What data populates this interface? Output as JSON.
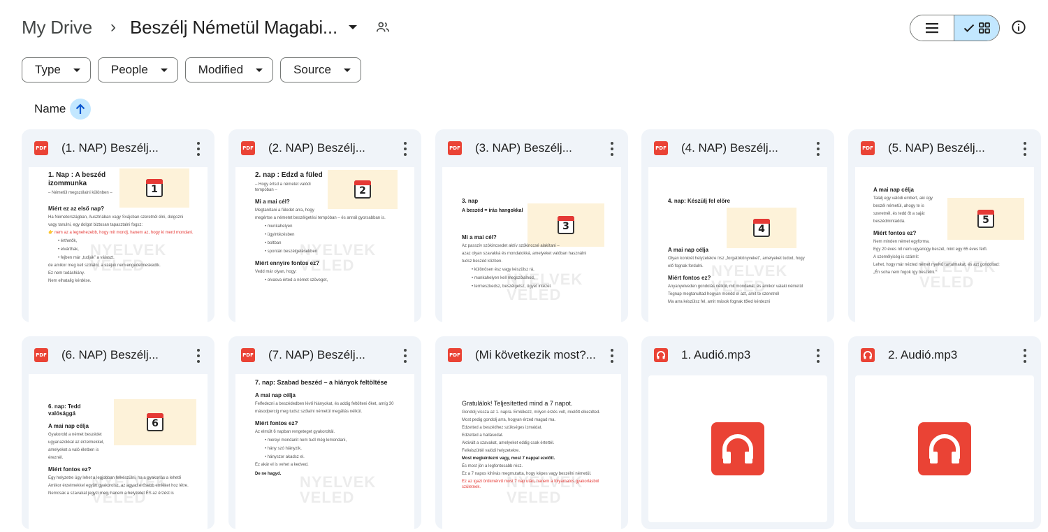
{
  "breadcrumb": {
    "root": "My Drive",
    "separator": "›",
    "current": "Beszélj Németül Magabi..."
  },
  "filters": [
    "Type",
    "People",
    "Modified",
    "Source"
  ],
  "sort": {
    "label": "Name"
  },
  "files": [
    {
      "title": "(1. NAP) Beszélj...",
      "type": "pdf",
      "icon_label": "PDF",
      "preview": {
        "heading": "1. Nap : A beszéd izommunka",
        "sub": "– Németül megszólalni különben –",
        "section": "Miért ez az első nap?",
        "lines": [
          "Ha Németországban, Ausztriában vagy Svájcban szeretnél élni, dolgozni",
          "vagy tanulni, egy dolgot biztosan tapasztalni fogsz:"
        ],
        "highlight": "👉 nem az a legnehezebb, hogy mit mondj, hanem az, hogy ki merd mondani.",
        "bullets": [
          "• érthetők,",
          "• elvárthak,",
          "• fejben már „tudják” a választ."
        ],
        "footer": [
          "de amikor meg kell szólalni, a szájuk nem engedelmeskedik.",
          "Ez nem tudáshiány.",
          "Nem elhatalig kérdése."
        ],
        "day_number": "1",
        "watermark": "NYELVEK VELED"
      }
    },
    {
      "title": "(2. NAP) Beszélj...",
      "type": "pdf",
      "icon_label": "PDF",
      "preview": {
        "heading": "2. nap : Edzd a füled",
        "sub": "– Hogy értsd a németet valódi tempóban –",
        "section": "Mi a mai cél?",
        "lines": [
          "Megtanítani a füledet arra, hogy",
          "megértse a németet beszélgetési tempóban – és annál gyorsabban is."
        ],
        "highlight": "",
        "bullets": [
          "• munkahelyen",
          "• ügyintézésben",
          "• boltban",
          "• spontán beszélgetésekben"
        ],
        "footer": [
          "Miért ennyire fontos ez?",
          "Vedd már olyan, hogy:",
          "• olvasva érted a német szöveget,"
        ],
        "day_number": "2",
        "watermark": "NYELVEK VELED"
      }
    },
    {
      "title": "(3. NAP) Beszélj...",
      "type": "pdf",
      "icon_label": "PDF",
      "preview": {
        "heading": "3. nap",
        "sub": "A beszéd = írás hangokkal",
        "section": "Mi a mai cél?",
        "lines": [
          "Az passzív szókincsedet aktív szókinccsé alakítani –",
          "azaz olyan szavakká és mondatokká, amelyeket valóban használni",
          "tudsz beszéd közben."
        ],
        "highlight": "",
        "bullets": [
          "• különösen ész vagy készülsz rá,",
          "• munkahelyen kell megszólalnod,",
          "• termeszkedsz, beszélgetsz, ügyet intézel."
        ],
        "footer": [],
        "day_number": "3",
        "watermark": "NYELVEK VELED"
      }
    },
    {
      "title": "(4. NAP) Beszélj...",
      "type": "pdf",
      "icon_label": "PDF",
      "preview": {
        "heading": "4. nap: Készülj fel előre",
        "sub": "",
        "section": "A mai nap célja",
        "lines": [
          "Olyan konkrét helyzetekre írsz „forgatókönyveket”, amelyeket tudod, hogy",
          "elő fognak fordulni."
        ],
        "highlight": "",
        "bullets": [],
        "footer": [
          "Miért fontos ez?",
          "Anyanyelveden gondolás nélkül, mit mondanál, és amikor valaki németül",
          "Tegnap megtanultad hogyan mondd el azt, amit te szeretnél",
          "Ma arra készülsz fel, amit mások fognak tőled kérdezni"
        ],
        "day_number": "4",
        "watermark": "NYELVEK VELED"
      }
    },
    {
      "title": "(5. NAP) Beszélj...",
      "type": "pdf",
      "icon_label": "PDF",
      "preview": {
        "heading": "A mai nap célja",
        "sub": "",
        "section": "Miért fontos ez?",
        "lines": [
          "Találj egy valódi embert, aki úgy",
          "beszél németül, ahogy te is",
          "szeretnél, és tedd őt a saját",
          "beszédmintáddá."
        ],
        "highlight": "",
        "bullets": [
          "Nem minden német egyforma.",
          "Egy 20 éves nő nem ugyanúgy beszél, mint egy 65 éves férfi."
        ],
        "footer": [
          "A személyiség is számít:",
          "Lehet, hogy már nézted német nyelvű tartalmakat, és azt gondoltad:",
          "„Én soha nem fogok így beszélni.”"
        ],
        "day_number": "5",
        "watermark": "NYELVEK VELED"
      }
    },
    {
      "title": "(6. NAP) Beszélj...",
      "type": "pdf",
      "icon_label": "PDF",
      "preview": {
        "heading": "6. nap: Tedd valósággá",
        "sub": "",
        "section": "A mai nap célja",
        "lines": [
          "Gyakorold a német beszédet",
          "ugyanazokkal az érzelmekkel,",
          "amelyeket a való életben is",
          "éreznél."
        ],
        "highlight": "",
        "bullets": [],
        "footer": [
          "Miért fontos ez?",
          "Egy helyzetre úgy lehet a legjobban felkészülni, ha a gyakorlás a lehető",
          "Amikor érzelmekkel együtt gyakorolsz, az agyad erősebb emléket hoz létre.",
          "Nemcsak a szavakat jegyzi meg, hanem a helyzetet ÉS az érzést is"
        ],
        "day_number": "6",
        "watermark": "NYELVEK VELED"
      }
    },
    {
      "title": "(7. NAP) Beszélj...",
      "type": "pdf",
      "icon_label": "PDF",
      "preview": {
        "heading": "7. nap: Szabad beszéd – a hiányok feltöltése",
        "sub": "",
        "section": "A mai nap célja",
        "lines": [
          "Felfedezni a beszédedben lévő hiányokat, és addig feltölteni őket, amíg 30",
          "másodpercig meg tudsz szólalni németül megállás nélkül."
        ],
        "highlight": "",
        "bullets": [
          "• mereyi mondanit nem tudl még lemondani,",
          "• hány szó hiányzik,",
          "• hányszor akadsz el."
        ],
        "footer": [
          "Miért fontos ez?",
          "Az elmúlt 6 napban rengeteget gyakoroltál.",
          "Ez akár el is vehet a kedved.",
          "De ne hagyd."
        ],
        "day_number": "7",
        "watermark": "NYELVEK VELED"
      }
    },
    {
      "title": "(Mi következik most?...",
      "type": "pdf",
      "icon_label": "PDF",
      "preview": {
        "heading": "Gratulálok! Teljesítetted mind a 7 napot.",
        "sub": "",
        "section": "Most megkérdezni vagy, most 7 nappal ezelőtt.",
        "lines": [
          "Gondolj vissza az 1. napra. Emlékezz, milyen érzés volt, mielőtt elkezdted.",
          "Most pedig gondolj arra, hogyan érzed magad ma."
        ],
        "highlight": "Ez az igazi örökmérvű most 7 nap után, hanem a folyamatos gyakorlásból születnek.",
        "bullets": [
          "Edzetted a beszédhez szükséges izmaidat.",
          "Edzetted a hallásodat.",
          "Aktivált a szavakat, amelyeket eddig csak értettél.",
          "Felkészültél valódi helyzetekre."
        ],
        "footer": [
          "És most jön a legfontosabb rész.",
          "Ez a 7 napos kihívás megmutatta, hogy képes vagy beszélni németül."
        ],
        "day_number": "",
        "watermark": "NYELVEK VELED"
      }
    },
    {
      "title": "1. Audió.mp3",
      "type": "audio"
    },
    {
      "title": "2. Audió.mp3",
      "type": "audio"
    }
  ],
  "icons": {
    "shared": "people-icon",
    "list_view": "list-icon",
    "grid_view": "grid-icon",
    "grid_check": "check-icon",
    "info": "info-icon",
    "sort": "arrow-up-icon",
    "kebab": "more-vert-icon",
    "pdf": "pdf-icon",
    "audio": "headphones-icon"
  },
  "colors": {
    "accent_light": "#c2e7ff",
    "card_bg": "#f0f4f9",
    "pdf_red": "#ea4335",
    "calendar_bg": "#fdf2d9"
  }
}
